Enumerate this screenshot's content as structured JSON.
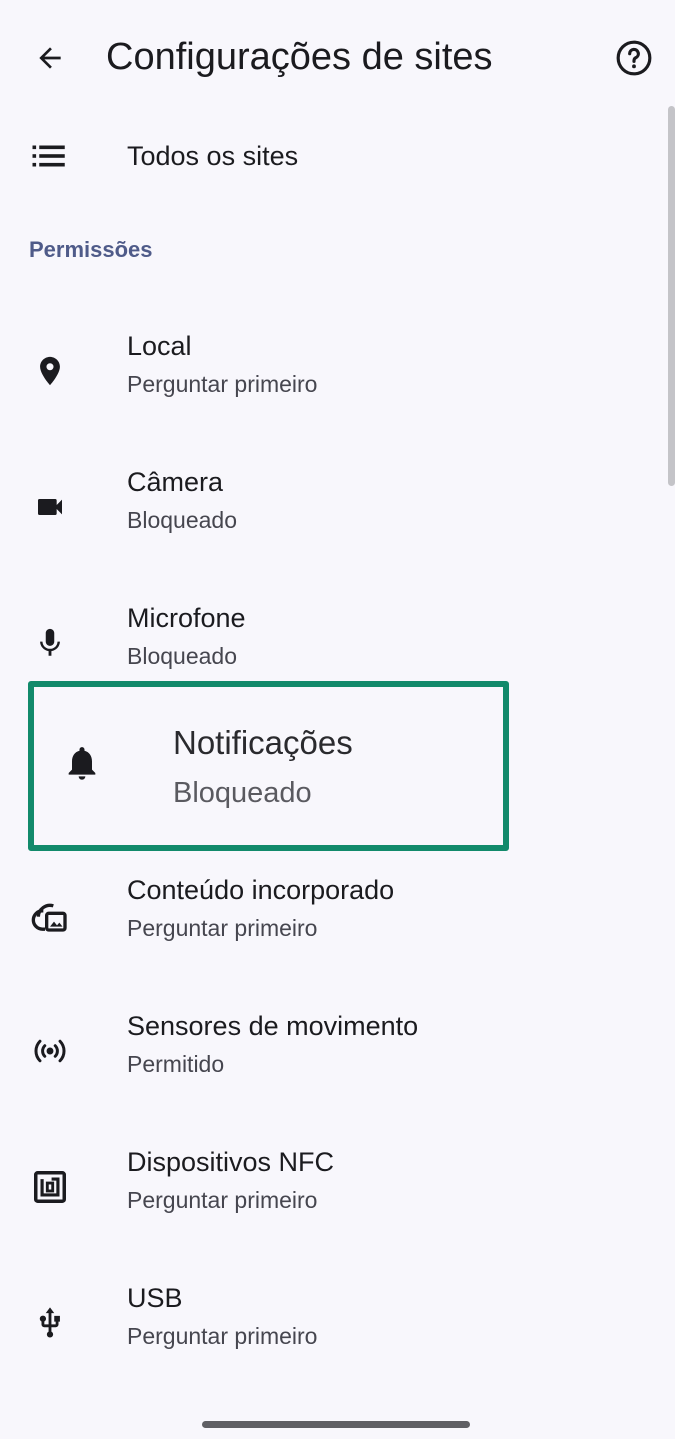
{
  "appbar": {
    "title": "Configurações de sites",
    "back_icon": "arrow-back-icon",
    "help_icon": "help-circle-icon"
  },
  "all_sites": {
    "label": "Todos os sites",
    "icon": "list-icon"
  },
  "section": {
    "permissions_header": "Permissões"
  },
  "permissions": [
    {
      "label": "Local",
      "status": "Perguntar primeiro",
      "icon": "location-pin-icon"
    },
    {
      "label": "Câmera",
      "status": "Bloqueado",
      "icon": "videocam-icon"
    },
    {
      "label": "Microfone",
      "status": "Bloqueado",
      "icon": "mic-icon"
    },
    {
      "label": "Notificações",
      "status": "Bloqueado",
      "icon": "bell-icon"
    },
    {
      "label": "Conteúdo incorporado",
      "status": "Perguntar primeiro",
      "icon": "embedded-content-icon"
    },
    {
      "label": "Sensores de movimento",
      "status": "Permitido",
      "icon": "sensors-icon"
    },
    {
      "label": "Dispositivos NFC",
      "status": "Perguntar primeiro",
      "icon": "nfc-icon"
    },
    {
      "label": "USB",
      "status": "Perguntar primeiro",
      "icon": "usb-icon"
    }
  ],
  "colors": {
    "background": "#f8f7fc",
    "section_header": "#4f5b89",
    "highlight_border": "#128a6b"
  }
}
